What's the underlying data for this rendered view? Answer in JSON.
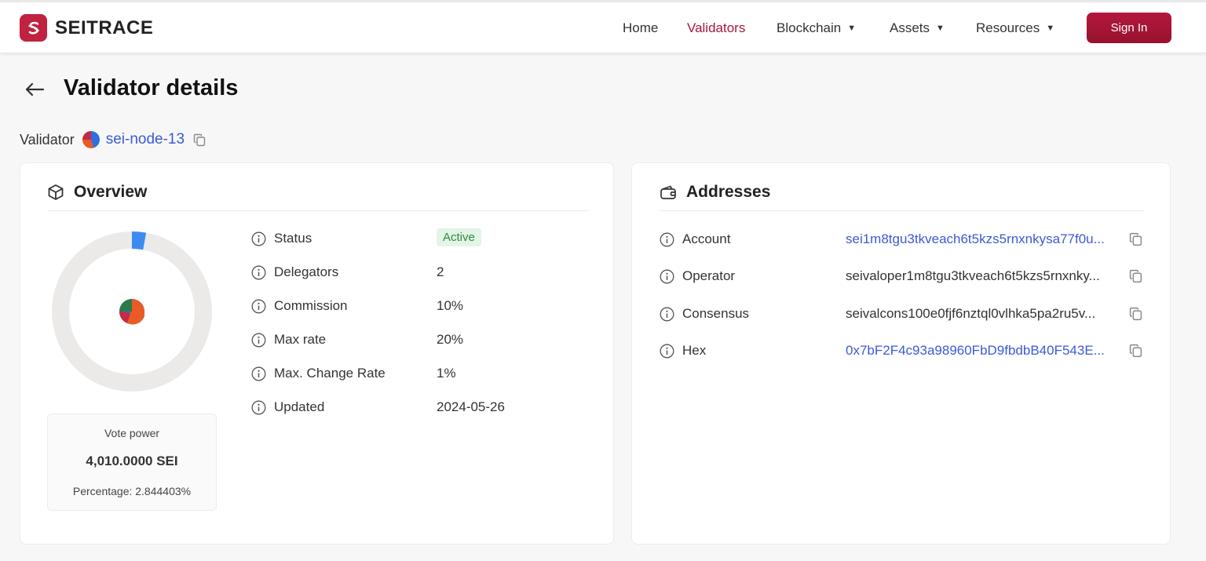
{
  "brand": {
    "name": "SEITRACE"
  },
  "nav": {
    "items": [
      {
        "label": "Home"
      },
      {
        "label": "Validators"
      },
      {
        "label": "Blockchain"
      },
      {
        "label": "Assets"
      },
      {
        "label": "Resources"
      }
    ],
    "signin_label": "Sign In",
    "accent_color": "#a8173a"
  },
  "page": {
    "title": "Validator details",
    "validator_label": "Validator",
    "validator_name": "sei-node-13"
  },
  "overview": {
    "title": "Overview",
    "vote_power_label": "Vote power",
    "vote_power_value": "4,010.0000 SEI",
    "percentage_text": "Percentage: 2.844403%",
    "percentage_fraction": 0.02844403,
    "rows": [
      {
        "label": "Status",
        "value": "Active"
      },
      {
        "label": "Delegators",
        "value": "2"
      },
      {
        "label": "Commission",
        "value": "10%"
      },
      {
        "label": "Max rate",
        "value": "20%"
      },
      {
        "label": "Max. Change Rate",
        "value": "1%"
      },
      {
        "label": "Updated",
        "value": "2024-05-26"
      }
    ]
  },
  "addresses": {
    "title": "Addresses",
    "rows": [
      {
        "label": "Account",
        "value": "sei1m8tgu3tkveach6t5kzs5rnxnkysa77f0u..."
      },
      {
        "label": "Operator",
        "value": "seivaloper1m8tgu3tkveach6t5kzs5rnxnky..."
      },
      {
        "label": "Consensus",
        "value": "seivalcons100e0fjf6nztql0vlhka5pa2ru5v..."
      },
      {
        "label": "Hex",
        "value": "0x7bF2F4c93a98960FbD9fbdbB40F543E..."
      }
    ]
  }
}
